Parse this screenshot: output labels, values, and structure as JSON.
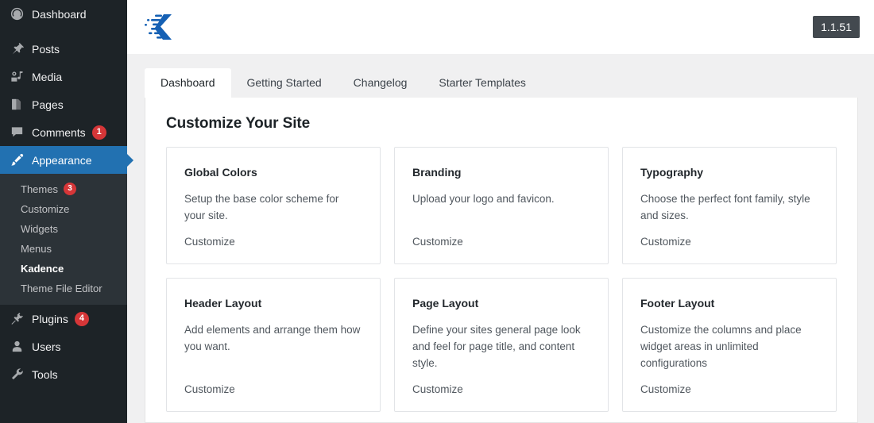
{
  "sidebar": {
    "items": [
      {
        "label": "Dashboard",
        "icon": "dashboard-gauge-icon",
        "name": "dashboard",
        "badge": null,
        "active": false
      },
      {
        "label": "Posts",
        "icon": "pushpin-icon",
        "name": "posts",
        "badge": null,
        "active": false
      },
      {
        "label": "Media",
        "icon": "media-icon",
        "name": "media",
        "badge": null,
        "active": false
      },
      {
        "label": "Pages",
        "icon": "pages-icon",
        "name": "pages",
        "badge": null,
        "active": false
      },
      {
        "label": "Comments",
        "icon": "comment-bubble-icon",
        "name": "comments",
        "badge": "1",
        "active": false
      },
      {
        "label": "Appearance",
        "icon": "paintbrush-icon",
        "name": "appearance",
        "badge": null,
        "active": true
      }
    ],
    "submenu": [
      {
        "label": "Themes",
        "badge": "3",
        "current": false
      },
      {
        "label": "Customize",
        "badge": null,
        "current": false
      },
      {
        "label": "Widgets",
        "badge": null,
        "current": false
      },
      {
        "label": "Menus",
        "badge": null,
        "current": false
      },
      {
        "label": "Kadence",
        "badge": null,
        "current": true
      },
      {
        "label": "Theme File Editor",
        "badge": null,
        "current": false
      }
    ],
    "items_bottom": [
      {
        "label": "Plugins",
        "icon": "plug-icon",
        "name": "plugins",
        "badge": "4"
      },
      {
        "label": "Users",
        "icon": "user-icon",
        "name": "users",
        "badge": null
      },
      {
        "label": "Tools",
        "icon": "wrench-icon",
        "name": "tools",
        "badge": null
      }
    ]
  },
  "header": {
    "logo_name": "kadence-logo",
    "version": "1.1.51"
  },
  "tabs": [
    {
      "label": "Dashboard",
      "name": "tab-dashboard",
      "active": true
    },
    {
      "label": "Getting Started",
      "name": "tab-getting-started",
      "active": false
    },
    {
      "label": "Changelog",
      "name": "tab-changelog",
      "active": false
    },
    {
      "label": "Starter Templates",
      "name": "tab-starter-templates",
      "active": false
    }
  ],
  "main": {
    "section_title": "Customize Your Site",
    "cards": [
      {
        "title": "Global Colors",
        "description": "Setup the base color scheme for your site.",
        "link": "Customize",
        "name": "card-global-colors"
      },
      {
        "title": "Branding",
        "description": "Upload your logo and favicon.",
        "link": "Customize",
        "name": "card-branding"
      },
      {
        "title": "Typography",
        "description": "Choose the perfect font family, style and sizes.",
        "link": "Customize",
        "name": "card-typography"
      },
      {
        "title": "Header Layout",
        "description": "Add elements and arrange them how you want.",
        "link": "Customize",
        "name": "card-header-layout"
      },
      {
        "title": "Page Layout",
        "description": "Define your sites general page look and feel for page title, and content style.",
        "link": "Customize",
        "name": "card-page-layout"
      },
      {
        "title": "Footer Layout",
        "description": "Customize the columns and place widget areas in unlimited configurations",
        "link": "Customize",
        "name": "card-footer-layout"
      }
    ]
  },
  "colors": {
    "sidebar_bg": "#1d2327",
    "submenu_bg": "#2c3338",
    "accent_blue": "#2271b1",
    "badge_red": "#d63638",
    "page_bg": "#f0f0f1",
    "logo_blue": "#1560b4",
    "version_bg": "#43494f"
  }
}
